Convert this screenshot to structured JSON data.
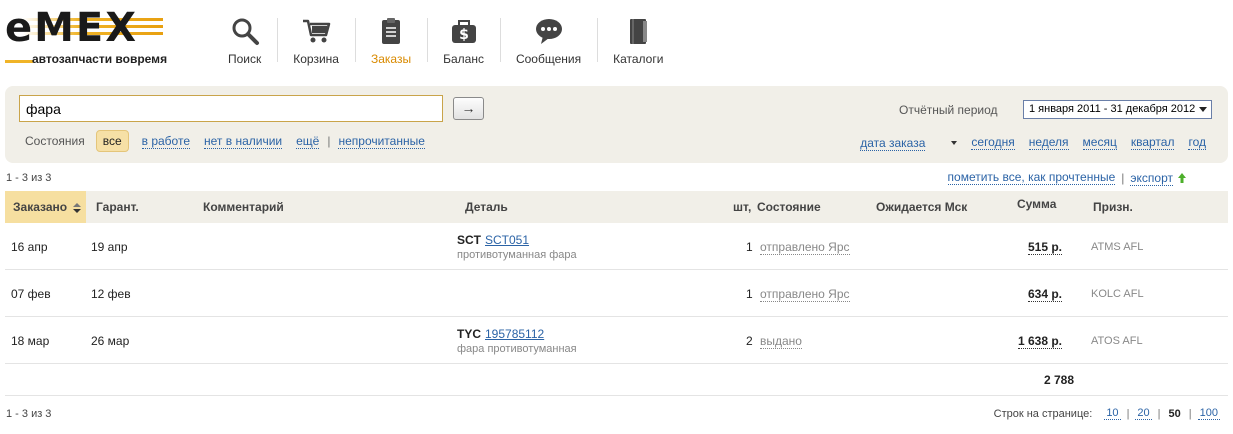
{
  "brand": {
    "logo_text": "eMEX",
    "tagline": "автозапчасти вовремя"
  },
  "nav": [
    {
      "label": "Поиск",
      "icon": "search-icon"
    },
    {
      "label": "Корзина",
      "icon": "cart-icon"
    },
    {
      "label": "Заказы",
      "icon": "clipboard-icon",
      "active": true
    },
    {
      "label": "Баланс",
      "icon": "money-bag-icon"
    },
    {
      "label": "Сообщения",
      "icon": "chat-bubble-icon"
    },
    {
      "label": "Каталоги",
      "icon": "books-icon"
    }
  ],
  "search": {
    "value": "фара",
    "go_label": "→"
  },
  "period": {
    "label": "Отчётный период",
    "value": "1 января 2011 - 31 декабря 2012"
  },
  "states": {
    "label": "Состояния",
    "all": "все",
    "in_work": "в работе",
    "unavailable": "нет в наличии",
    "more": "ещё",
    "separator": "|",
    "unread": "непрочитанные"
  },
  "range": {
    "date_sort": "дата заказа",
    "today": "сегодня",
    "week": "неделя",
    "month": "месяц",
    "quarter": "квартал",
    "year": "год"
  },
  "count": "1 - 3 из 3",
  "actions": {
    "mark_read": "пометить все, как прочтенные",
    "separator": "|",
    "export": "экспорт"
  },
  "columns": {
    "ordered": "Заказано",
    "guarantee": "Гарант.",
    "comment": "Комментарий",
    "part": "Деталь",
    "qty": "шт,",
    "state": "Состояние",
    "expected": "Ожидается Мск",
    "sum": "Сумма",
    "sign": "Призн."
  },
  "rows": [
    {
      "ordered": "16 апр",
      "guarantee": "19 апр",
      "brand": "SCT",
      "number": "SCT051",
      "desc": "противотуманная фара",
      "qty": "1",
      "state": "отправлено Ярс",
      "sum": "515 р.",
      "sign": "ATMS AFL"
    },
    {
      "ordered": "07 фев",
      "guarantee": "12 фев",
      "brand": "",
      "number": "",
      "desc": "",
      "qty": "1",
      "state": "отправлено Ярс",
      "sum": "634 р.",
      "sign": "KOLC AFL"
    },
    {
      "ordered": "18 мар",
      "guarantee": "26 мар",
      "brand": "TYC",
      "number": "195785112",
      "desc": "фара противотуманная",
      "qty": "2",
      "state": "выдано",
      "sum": "1 638 р.",
      "sign": "ATOS AFL"
    }
  ],
  "total": "2 788",
  "pager": {
    "label": "Строк на странице:",
    "sizes": [
      "10",
      "20",
      "50",
      "100"
    ],
    "current": "50",
    "separator": "|"
  },
  "colors": {
    "accent": "#d98a00",
    "link": "#2b63a6",
    "panel": "#f1efe8",
    "chip": "#f6e0a6"
  }
}
